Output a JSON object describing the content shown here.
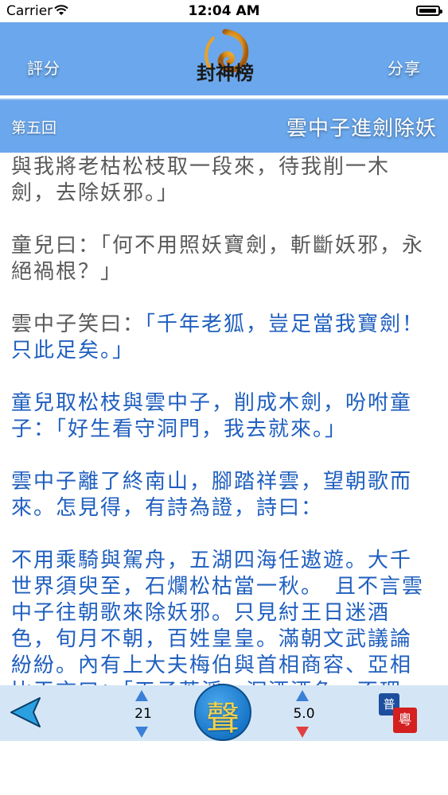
{
  "status_bar": {
    "carrier": "Carrier",
    "time": "12:04 AM",
    "battery_level": 0.95
  },
  "header": {
    "rate_label": "評分",
    "share_label": "分享",
    "logo_text": "封神榜"
  },
  "chapter": {
    "number": "第五回",
    "title": "雲中子進劍除妖"
  },
  "content": {
    "paragraphs": [
      {
        "text": "與我將老枯松枝取一段來，待我削一木劍，去除妖邪。」",
        "style": "grey"
      },
      {
        "text": "童兒曰：「何不用照妖寶劍，斬斷妖邪，永絕禍根？」",
        "style": "grey"
      },
      {
        "text": "雲中子笑曰：",
        "style": "grey",
        "cont": "「千年老狐，豈足當我寶劍！只此足矣。」"
      },
      {
        "text": "童兒取松枝與雲中子，削成木劍，吩咐童子：「好生看守洞門，我去就來。」",
        "style": "blue"
      },
      {
        "text": "雲中子離了終南山，腳踏祥雲，望朝歌而來。怎見得，有詩為證，詩曰：",
        "style": "blue"
      },
      {
        "text": "不用乘騎與駕舟，五湖四海任遨遊。大千世界須臾至，石爛松枯當一秋。　且不言雲中子往朝歌來除妖邪。只見紂王日迷酒色，旬月不朝，百姓皇皇。滿朝文武議論紛紛。內有上大夫梅伯與首相商容、亞相比干言曰：「天子荒淫，沉酒酒色，不理",
        "style": "blue"
      }
    ]
  },
  "toolbar": {
    "font_size": "21",
    "voice_label": "聲",
    "speed": "5.0",
    "lang_mandarin": "普",
    "lang_cantonese": "粵"
  },
  "colors": {
    "header_bg": "#6aa7ec",
    "toolbar_bg": "#d4e6f6",
    "text_grey": "#5a5a5a",
    "text_blue": "#1f5fbf"
  }
}
